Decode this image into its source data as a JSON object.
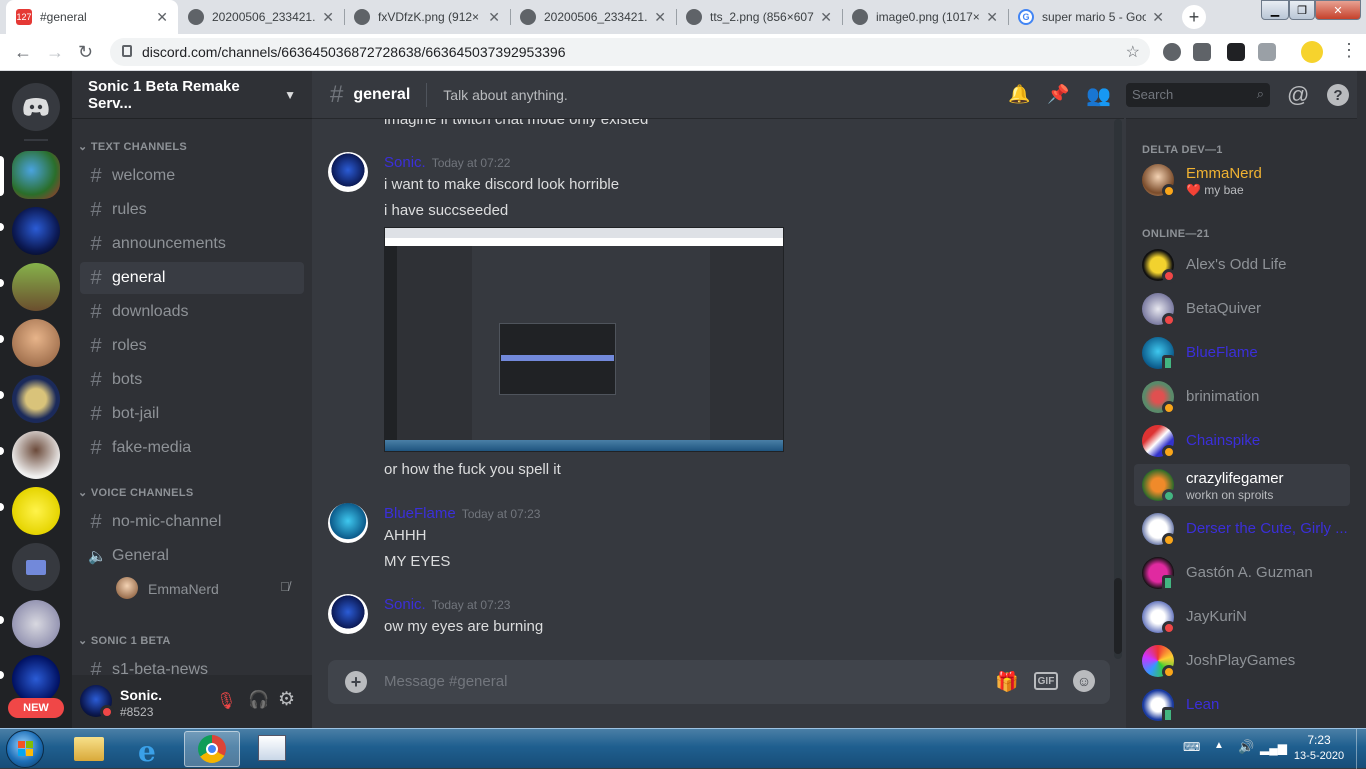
{
  "browser": {
    "tabs": [
      {
        "title": "#general",
        "badge": "127",
        "active": true
      },
      {
        "title": "20200506_233421.p"
      },
      {
        "title": "fxVDfzK.png (912×"
      },
      {
        "title": "20200506_233421.p"
      },
      {
        "title": "tts_2.png (856×607"
      },
      {
        "title": "image0.png (1017×"
      },
      {
        "title": "super mario 5 - Goo"
      }
    ],
    "url": "discord.com/channels/663645036872728638/663645037392953396"
  },
  "server": {
    "name": "Sonic 1 Beta Remake Serv...",
    "categories": {
      "text": "TEXT CHANNELS",
      "voice": "VOICE CHANNELS",
      "beta": "SONIC 1 BETA"
    },
    "text_channels": [
      "welcome",
      "rules",
      "announcements",
      "general",
      "downloads",
      "roles",
      "bots",
      "bot-jail",
      "fake-media"
    ],
    "voice_channels": [
      "no-mic-channel",
      "General"
    ],
    "voice_user": "EmmaNerd",
    "beta_channels": [
      "s1-beta-news"
    ],
    "new_badge": "NEW"
  },
  "user": {
    "name": "Sonic.",
    "tag": "#8523"
  },
  "channel": {
    "name": "general",
    "topic": "Talk about anything."
  },
  "search": {
    "placeholder": "Search"
  },
  "messages": {
    "partial": "imagine if twitch chat mode only existed",
    "groups": [
      {
        "author": "Sonic.",
        "time": "Today at 07:22",
        "lines": [
          "i want to make discord look horrible",
          "i have succseeded"
        ],
        "after_image": "or how the fuck you spell it"
      },
      {
        "author": "BlueFlame",
        "time": "Today at 07:23",
        "lines": [
          "AHHH",
          "MY EYES"
        ]
      },
      {
        "author": "Sonic.",
        "time": "Today at 07:23",
        "lines": [
          "ow my eyes are burning"
        ]
      }
    ]
  },
  "composer": {
    "placeholder": "Message #general",
    "gif": "GIF"
  },
  "members": {
    "role": "DELTA DEV—1",
    "dev": {
      "name": "EmmaNerd",
      "status": "❤️ my bae"
    },
    "online_header": "ONLINE—21",
    "online": [
      {
        "name": "Alex's Odd Life",
        "status": "dnd"
      },
      {
        "name": "BetaQuiver",
        "status": "dnd"
      },
      {
        "name": "BlueFlame",
        "status": "mobile",
        "color": "#3b2fd9"
      },
      {
        "name": "brinimation",
        "status": "idle"
      },
      {
        "name": "Chainspike",
        "status": "idle",
        "color": "#3b2fd9"
      },
      {
        "name": "crazylifegamer",
        "status": "online",
        "activity": "workn on sproits",
        "highlight": true
      },
      {
        "name": "Derser the Cute, Girly ...",
        "status": "idle",
        "color": "#3b2fd9"
      },
      {
        "name": "Gastón A. Guzman",
        "status": "mobile"
      },
      {
        "name": "JayKuriN",
        "status": "dnd"
      },
      {
        "name": "JoshPlayGames",
        "status": "idle"
      },
      {
        "name": "Lean",
        "status": "mobile",
        "color": "#3b2fd9"
      }
    ]
  },
  "colors": {
    "name_purple": "#3b2fd9",
    "emma": "#f0b232",
    "online": "#43b581",
    "idle": "#faa61a",
    "dnd": "#f04747"
  },
  "taskbar": {
    "time": "7:23",
    "date": "13-5-2020"
  }
}
